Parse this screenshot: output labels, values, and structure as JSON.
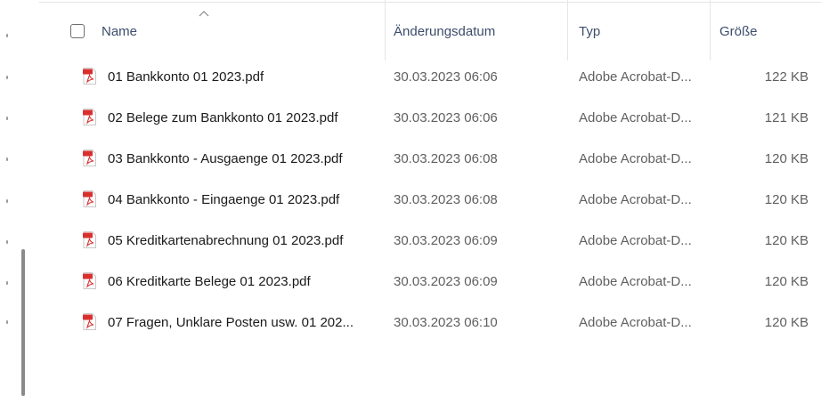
{
  "columns": {
    "name": "Name",
    "modified": "Änderungsdatum",
    "type": "Typ",
    "size": "Größe"
  },
  "sort": {
    "column": "name",
    "indicator": "chevron-up-icon"
  },
  "files": [
    {
      "name": "01 Bankkonto 01 2023.pdf",
      "modified": "30.03.2023 06:06",
      "type": "Adobe Acrobat-D...",
      "size": "122 KB",
      "icon": "pdf-icon"
    },
    {
      "name": "02 Belege zum Bankkonto 01 2023.pdf",
      "modified": "30.03.2023 06:06",
      "type": "Adobe Acrobat-D...",
      "size": "121 KB",
      "icon": "pdf-icon"
    },
    {
      "name": "03 Bankkonto - Ausgaenge 01 2023.pdf",
      "modified": "30.03.2023 06:08",
      "type": "Adobe Acrobat-D...",
      "size": "120 KB",
      "icon": "pdf-icon"
    },
    {
      "name": "04 Bankkonto - Eingaenge 01 2023.pdf",
      "modified": "30.03.2023 06:08",
      "type": "Adobe Acrobat-D...",
      "size": "120 KB",
      "icon": "pdf-icon"
    },
    {
      "name": "05 Kreditkartenabrechnung 01 2023.pdf",
      "modified": "30.03.2023 06:09",
      "type": "Adobe Acrobat-D...",
      "size": "120 KB",
      "icon": "pdf-icon"
    },
    {
      "name": "06 Kreditkarte Belege 01 2023.pdf",
      "modified": "30.03.2023 06:09",
      "type": "Adobe Acrobat-D...",
      "size": "120 KB",
      "icon": "pdf-icon"
    },
    {
      "name": "07 Fragen, Unklare Posten usw. 01 202...",
      "modified": "30.03.2023 06:10",
      "type": "Adobe Acrobat-D...",
      "size": "120 KB",
      "icon": "pdf-icon"
    }
  ],
  "colors": {
    "header_text": "#3c4d6b",
    "secondary_text": "#5f5f5f",
    "pdf_red": "#d9302f"
  }
}
